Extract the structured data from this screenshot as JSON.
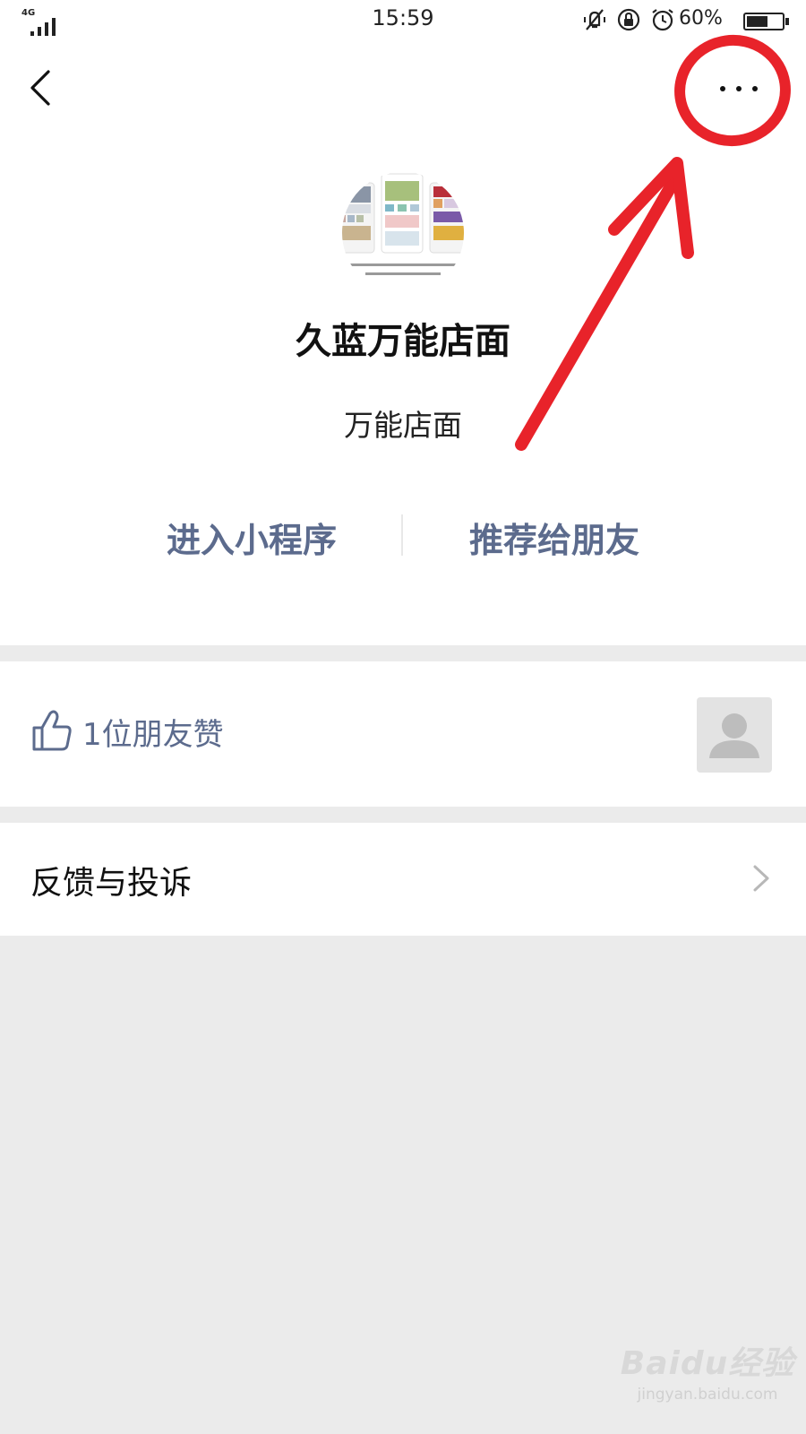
{
  "status_bar": {
    "network": "4G",
    "time": "15:59",
    "battery_percent": "60%",
    "battery_level": 0.6,
    "icons": [
      "signal-icon",
      "vibrate-mute-icon",
      "rotation-lock-icon",
      "alarm-icon",
      "battery-icon"
    ]
  },
  "nav": {
    "back_icon": "chevron-left-icon",
    "more_icon": "more-dots-icon"
  },
  "app": {
    "name": "久蓝万能店面",
    "description": "万能店面"
  },
  "actions": {
    "enter_label": "进入小程序",
    "share_label": "推荐给朋友"
  },
  "likes": {
    "text": "1位朋友赞",
    "icon": "thumbs-up-icon"
  },
  "feedback": {
    "label": "反馈与投诉",
    "icon": "chevron-right-icon"
  },
  "watermark": {
    "logo": "Baidu经验",
    "url": "jingyan.baidu.com"
  },
  "colors": {
    "accent_text": "#5c6b8d",
    "annotation_red": "#e8232a",
    "background": "#ebebeb"
  }
}
